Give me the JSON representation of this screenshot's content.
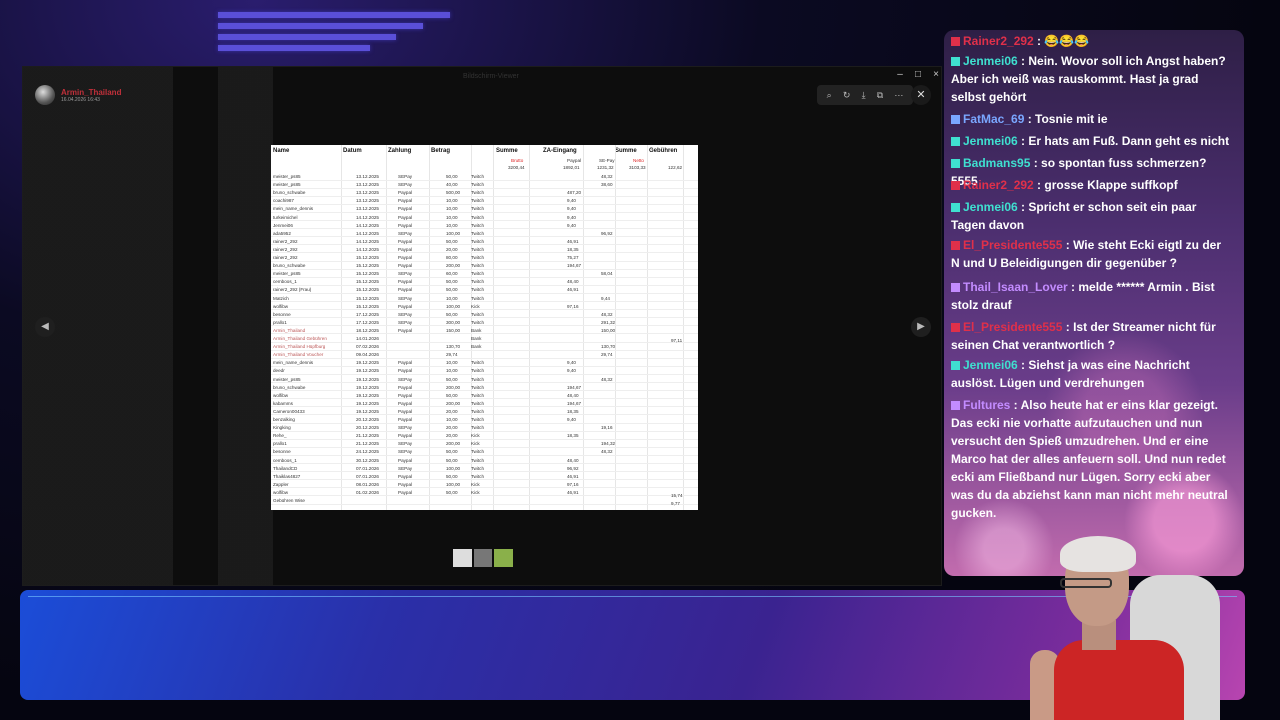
{
  "viewer": {
    "author_name": "Armin_Thailand",
    "author_date": "16.04.2026 16:43",
    "window_title": "Bildschirm-Viewer"
  },
  "sheet": {
    "headers": [
      "Name",
      "Datum",
      "Zahlung",
      "Betrag",
      "Summe",
      "ZA-Eingang",
      "Summe",
      "Gebühren"
    ],
    "subheaders": [
      "Brutto",
      "Paypal",
      "SE-Pay",
      "Netto"
    ],
    "totals": [
      "3200,44",
      "1892,01",
      "1231,32",
      "3103,33",
      "122,62"
    ],
    "rows": [
      [
        "meister_ps85",
        "13.12.2025",
        "SEPay",
        "50,00",
        "Twitch",
        "",
        "48,32"
      ],
      [
        "meister_ps85",
        "13.12.2025",
        "SEPay",
        "40,00",
        "Twitch",
        "",
        "38,60"
      ],
      [
        "bruno_schwabe",
        "13.12.2025",
        "Paypal",
        "500,00",
        "Twitch",
        "487,20",
        ""
      ],
      [
        "coachi987",
        "13.12.2025",
        "Paypal",
        "10,00",
        "Twitch",
        "9,40",
        ""
      ],
      [
        "mein_name_dennis",
        "13.12.2025",
        "Paypal",
        "10,00",
        "Twitch",
        "9,40",
        ""
      ],
      [
        "turkeimichel",
        "14.12.2025",
        "Paypal",
        "10,00",
        "Twitch",
        "9,40",
        ""
      ],
      [
        "Jenmei06",
        "14.12.2025",
        "Paypal",
        "10,00",
        "Twitch",
        "9,40",
        ""
      ],
      [
        "ada5952",
        "14.12.2025",
        "SEPay",
        "100,00",
        "Twitch",
        "",
        "96,92"
      ],
      [
        "rainer2_292",
        "14.12.2025",
        "Paypal",
        "50,00",
        "Twitch",
        "46,91",
        ""
      ],
      [
        "rainer2_292",
        "14.12.2025",
        "Paypal",
        "20,00",
        "Twitch",
        "18,35",
        ""
      ],
      [
        "rainer2_292",
        "15.12.2025",
        "Paypal",
        "80,00",
        "Twitch",
        "75,27",
        ""
      ],
      [
        "bruno_schwabe",
        "15.12.2025",
        "Paypal",
        "200,00",
        "Twitch",
        "194,67",
        ""
      ],
      [
        "meister_ps85",
        "15.12.2025",
        "SEPay",
        "60,00",
        "Twitch",
        "",
        "58,04"
      ],
      [
        "cemboos_1",
        "15.12.2025",
        "Paypal",
        "50,00",
        "Twitch",
        "48,40",
        ""
      ],
      [
        "rainer2_292 (Frau)",
        "15.12.2025",
        "Paypal",
        "50,00",
        "Twitch",
        "46,91",
        ""
      ],
      [
        "Matzich",
        "15.12.2025",
        "SEPay",
        "10,00",
        "Twitch",
        "",
        "9,44"
      ],
      [
        "wolfibw",
        "15.12.2025",
        "Paypal",
        "100,00",
        "Kick",
        "97,16",
        ""
      ],
      [
        "besonne",
        "17.12.2025",
        "SEPay",
        "50,00",
        "Twitch",
        "",
        "48,32"
      ],
      [
        "prallo1",
        "17.12.2025",
        "SEPay",
        "300,00",
        "Twitch",
        "",
        "291,32"
      ],
      [
        "Armin_Thailand",
        "18.12.2025",
        "Paypal",
        "150,00",
        "Bank",
        "",
        "150,00"
      ],
      [
        "Armin_Thailand Gebühren",
        "14.01.2026",
        "",
        "",
        "Bank",
        "",
        ""
      ],
      [
        "Armin_Thailand Hüpfburg",
        "07.02.2026",
        "",
        "130,70",
        "Bank",
        "",
        "130,70"
      ],
      [
        "Armin_Thailand Voucher",
        "09.04.2026",
        "",
        "29,74",
        "",
        "",
        "29,74"
      ],
      [
        "mein_name_dennis",
        "19.12.2025",
        "Paypal",
        "10,00",
        "Twitch",
        "9,40",
        ""
      ],
      [
        "deedr",
        "19.12.2025",
        "Paypal",
        "10,00",
        "Twitch",
        "9,40",
        ""
      ],
      [
        "meister_ps85",
        "19.12.2025",
        "SEPay",
        "50,00",
        "Twitch",
        "",
        "48,32"
      ],
      [
        "bruno_schwabe",
        "19.12.2025",
        "Paypal",
        "200,00",
        "Twitch",
        "194,67",
        ""
      ],
      [
        "wolfibw",
        "19.12.2025",
        "Paypal",
        "50,00",
        "Twitch",
        "48,40",
        ""
      ],
      [
        "kabamms",
        "19.12.2025",
        "Paypal",
        "200,00",
        "Twitch",
        "194,67",
        ""
      ],
      [
        "Cameron00433",
        "19.12.2025",
        "Paypal",
        "20,00",
        "Twitch",
        "18,35",
        ""
      ],
      [
        "benzalking",
        "20.12.2025",
        "Paypal",
        "10,00",
        "Twitch",
        "9,40",
        ""
      ],
      [
        "Kingking",
        "20.12.2025",
        "SEPay",
        "20,00",
        "Twitch",
        "",
        "19,16"
      ],
      [
        "Rehe_",
        "21.12.2025",
        "Paypal",
        "20,00",
        "Kick",
        "18,35",
        ""
      ],
      [
        "prallo1",
        "21.12.2025",
        "SEPay",
        "200,00",
        "Kick",
        "",
        "194,32"
      ],
      [
        "besonne",
        "24.12.2025",
        "SEPay",
        "50,00",
        "Twitch",
        "",
        "48,32"
      ],
      [
        "cemboos_1",
        "30.12.2025",
        "Paypal",
        "50,00",
        "Twitch",
        "48,40",
        ""
      ],
      [
        "ThailandCD",
        "07.01.2026",
        "SEPay",
        "100,00",
        "Twitch",
        "96,92",
        ""
      ],
      [
        "Thaiklas4827",
        "07.01.2026",
        "Paypal",
        "50,00",
        "Twitch",
        "46,91",
        ""
      ],
      [
        "Zappler",
        "08.01.2026",
        "Paypal",
        "100,00",
        "Kick",
        "97,16",
        ""
      ],
      [
        "wolfibw",
        "01.02.2026",
        "Paypal",
        "50,00",
        "Kick",
        "46,91",
        ""
      ],
      [
        "Gebühren Wise",
        "",
        "",
        "",
        "",
        "",
        ""
      ]
    ],
    "fee_values": [
      "97,11",
      "15,74",
      "9,77"
    ]
  },
  "chat": {
    "messages": [
      {
        "user": "Rainer2_292",
        "text": " : 😂😂😂",
        "color": "#e0304a"
      },
      {
        "user": "Jenmei06",
        "text": " : Nein. Wovor soll ich Angst haben? Aber ich weiß was rauskommt. Hast ja grad selbst gehört",
        "color": "#3fe0d0"
      },
      {
        "user": "FatMac_69",
        "text": " : Tosnie mit ie",
        "color": "#7aa7ff"
      },
      {
        "user": "Jenmei06",
        "text": " : Er hats am Fuß. Dann geht es nicht",
        "color": "#3fe0d0"
      },
      {
        "user": "Badmans95",
        "text": " : so spontan fuss schmerzen? 5555",
        "color": "#3fe0d0"
      },
      {
        "user": "Rainer2_292",
        "text": " : grosse Klappe suffkopf",
        "color": "#e0304a"
      },
      {
        "user": "Jenmei06",
        "text": " : Spricht er schon seit ein paar Tagen davon",
        "color": "#3fe0d0"
      },
      {
        "user": "El_Presidente555",
        "text": " : Wie steht Ecki eigtl zu der N und U Beleidigungen dir gegenüber ?",
        "color": "#e0304a"
      },
      {
        "user": "Thail_Isaan_Lover",
        "text": " : melde ****** Armin . Bist stolz drauf",
        "color": "#c38cff"
      },
      {
        "user": "El_Presidente555",
        "text": " : Ist der Streamer nicht für seinen Chat verantwortlich ?",
        "color": "#e0304a"
      },
      {
        "user": "Jenmei06",
        "text": " : Siehst ja was eine Nachricht auslöst. Lügen und verdrehungen",
        "color": "#3fe0d0"
      },
      {
        "user": "Fultures",
        "text": " : Also heute hat er eins klar gezeigt. Das ecki nie vorhatte aufzutauchen und nun versucht den Spieß umzudrehen. Und er eine Marco hat der alles anfeuern soll. Und nun redet ecki am Fließband nur Lügen. Sorry ecki aber was du da abziehst kann man nicht mehr neutral gucken.",
        "color": "#c38cff"
      }
    ]
  }
}
